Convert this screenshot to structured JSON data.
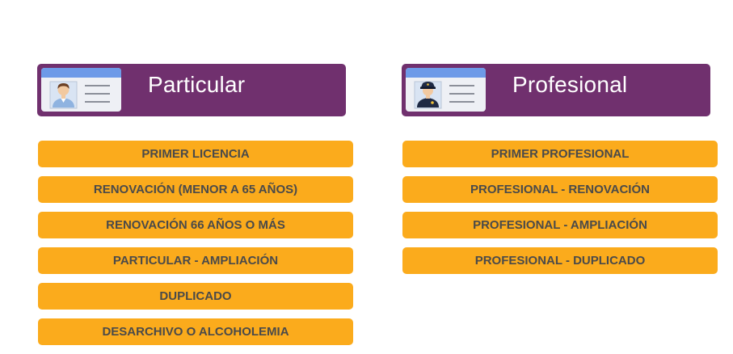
{
  "colors": {
    "header_bg": "#70306e",
    "button_bg": "#fbab1c",
    "button_text": "#4a4a4a",
    "card_top": "#6d9ae8",
    "card_body": "#eef0f5"
  },
  "particular": {
    "title": "Particular",
    "icon": "id-card-person-icon",
    "buttons": [
      "PRIMER LICENCIA",
      "RENOVACIÓN (MENOR A 65 AÑOS)",
      "RENOVACIÓN 66 AÑOS O MÁS",
      "PARTICULAR - AMPLIACIÓN",
      "DUPLICADO",
      "DESARCHIVO O ALCOHOLEMIA"
    ]
  },
  "profesional": {
    "title": "Profesional",
    "icon": "id-card-police-icon",
    "buttons": [
      "PRIMER PROFESIONAL",
      "PROFESIONAL - RENOVACIÓN",
      "PROFESIONAL - AMPLIACIÓN",
      "PROFESIONAL - DUPLICADO"
    ]
  }
}
